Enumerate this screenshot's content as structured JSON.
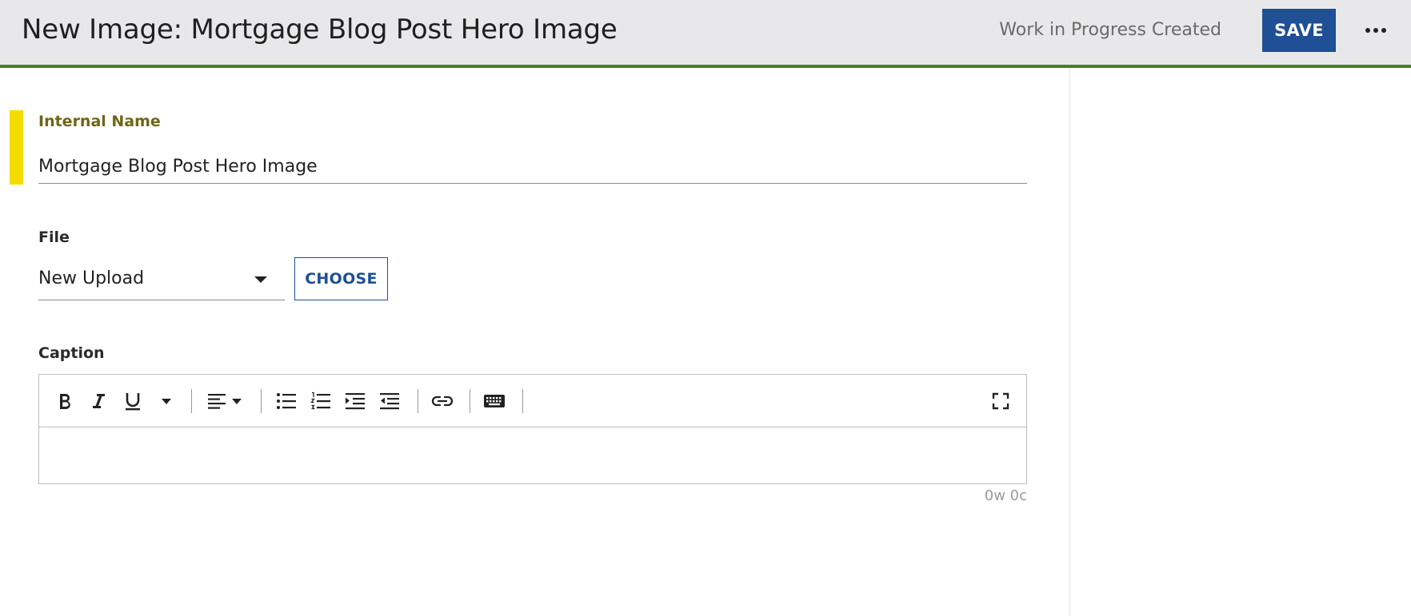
{
  "header": {
    "title": "New Image: Mortgage Blog Post Hero Image",
    "status": "Work in Progress Created",
    "save_label": "SAVE",
    "more_icon": "more-horizontal-icon"
  },
  "form": {
    "internal_name": {
      "label": "Internal Name",
      "value": "Mortgage Blog Post Hero Image",
      "required": true
    },
    "file": {
      "label": "File",
      "selected_option": "New Upload",
      "choose_label": "CHOOSE"
    },
    "caption": {
      "label": "Caption",
      "value": "",
      "counter": "0w 0c",
      "toolbar": [
        "bold-icon",
        "italic-icon",
        "underline-icon",
        "more-styles-dropdown-icon",
        "align-left-dropdown-icon",
        "bulleted-list-icon",
        "numbered-list-icon",
        "indent-icon",
        "outdent-icon",
        "link-icon",
        "keyboard-icon",
        "fullscreen-icon"
      ]
    }
  },
  "colors": {
    "accent": "#1f4f94",
    "header_bg": "#e8e8ea",
    "header_border": "#4a7f1e",
    "required_marker": "#f5dc00",
    "required_label": "#6f6516"
  }
}
